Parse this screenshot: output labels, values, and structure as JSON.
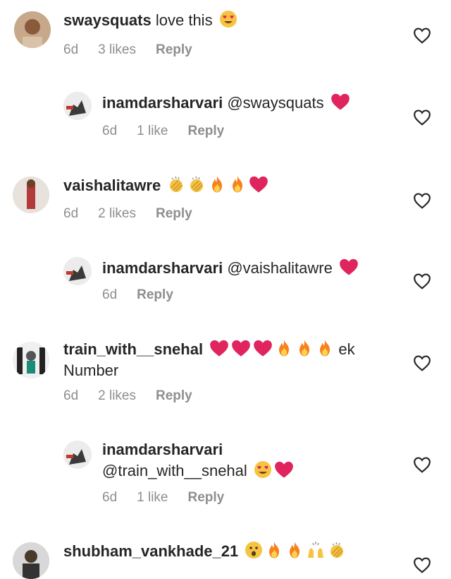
{
  "comments": [
    {
      "username": "swaysquats",
      "text": "love this",
      "time": "6d",
      "likes": "3 likes",
      "reply": "Reply"
    },
    {
      "username": "inamdarsharvari",
      "text": "@swaysquats",
      "time": "6d",
      "likes": "1 like",
      "reply": "Reply"
    },
    {
      "username": "vaishalitawre",
      "text": "",
      "time": "6d",
      "likes": "2 likes",
      "reply": "Reply"
    },
    {
      "username": "inamdarsharvari",
      "text": "@vaishalitawre",
      "time": "6d",
      "likes": "",
      "reply": "Reply"
    },
    {
      "username": "train_with__snehal",
      "text_a": "ek",
      "text_b": "Number",
      "time": "6d",
      "likes": "2 likes",
      "reply": "Reply"
    },
    {
      "username": "inamdarsharvari",
      "text": "@train_with__snehal",
      "time": "6d",
      "likes": "1 like",
      "reply": "Reply"
    },
    {
      "username": "shubham_vankhade_21",
      "text": ""
    }
  ],
  "icons": {
    "like": "heart-outline-icon",
    "heart": "red-heart-emoji",
    "fire": "fire-emoji",
    "clap": "clapping-hands-emoji",
    "heart_eyes": "heart-eyes-emoji",
    "raised": "raising-hands-emoji",
    "surprised": "surprised-face-emoji"
  },
  "colors": {
    "meta": "#8e8e8e",
    "heart": "#e0245e",
    "fire": "#f5a623"
  }
}
